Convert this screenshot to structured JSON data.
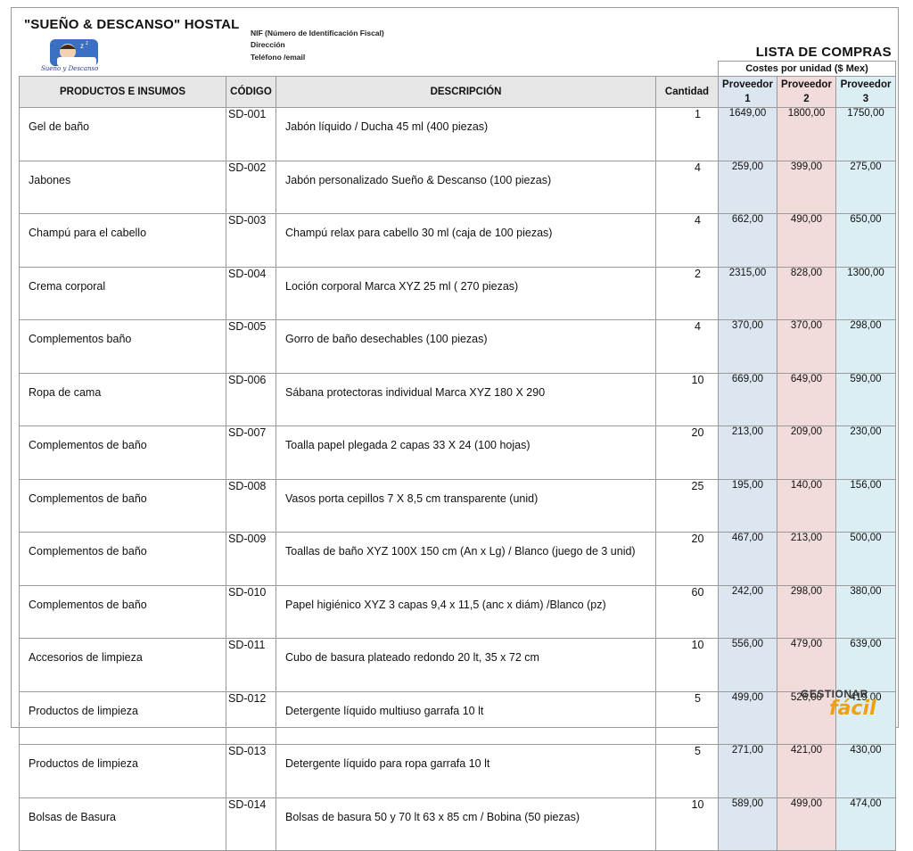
{
  "header": {
    "hostal_name": "\"SUEÑO & DESCANSO\"  HOSTAL",
    "logo_caption": "Sueño y Descanso",
    "nif": "NIF (Número de Identificación Fiscal)",
    "direccion": "Dirección",
    "telefono": "Teléfono /email",
    "list_title": "LISTA DE COMPRAS"
  },
  "columns": {
    "producto": "PRODUCTOS E INSUMOS",
    "codigo": "CÓDIGO",
    "descripcion": "DESCRIPCIÓN",
    "cantidad": "Cantidad",
    "costes": "Costes por unidad ($ Mex)",
    "prov1": "Proveedor 1",
    "prov2": "Proveedor 2",
    "prov3": "Proveedor 3"
  },
  "rows": [
    {
      "producto": "Gel de baño",
      "codigo": "SD-001",
      "descripcion": "Jabón líquido / Ducha 45 ml  (400 piezas)",
      "cantidad": "1",
      "p1": "1649,00",
      "p2": "1800,00",
      "p3": "1750,00"
    },
    {
      "producto": "Jabones",
      "codigo": "SD-002",
      "descripcion": "Jabón  personalizado Sueño & Descanso (100 piezas)",
      "cantidad": "4",
      "p1": "259,00",
      "p2": "399,00",
      "p3": "275,00"
    },
    {
      "producto": "Champú para el cabello",
      "codigo": "SD-003",
      "descripcion": "Champú relax para cabello 30 ml (caja de 100 piezas)",
      "cantidad": "4",
      "p1": "662,00",
      "p2": "490,00",
      "p3": "650,00"
    },
    {
      "producto": "Crema corporal",
      "codigo": "SD-004",
      "descripcion": "Loción corporal Marca XYZ 25 ml ( 270 piezas)",
      "cantidad": "2",
      "p1": "2315,00",
      "p2": "828,00",
      "p3": "1300,00"
    },
    {
      "producto": "Complementos baño",
      "codigo": "SD-005",
      "descripcion": "Gorro de baño desechables (100 piezas)",
      "cantidad": "4",
      "p1": "370,00",
      "p2": "370,00",
      "p3": "298,00"
    },
    {
      "producto": "Ropa de cama",
      "codigo": "SD-006",
      "descripcion": "Sábana protectoras individual Marca XYZ 180 X 290",
      "cantidad": "10",
      "p1": "669,00",
      "p2": "649,00",
      "p3": "590,00"
    },
    {
      "producto": "Complementos de baño",
      "codigo": "SD-007",
      "descripcion": "Toalla papel plegada 2 capas 33 X 24 (100 hojas)",
      "cantidad": "20",
      "p1": "213,00",
      "p2": "209,00",
      "p3": "230,00"
    },
    {
      "producto": "Complementos de baño",
      "codigo": "SD-008",
      "descripcion": "Vasos porta cepillos 7 X 8,5 cm transparente (unid)",
      "cantidad": "25",
      "p1": "195,00",
      "p2": "140,00",
      "p3": "156,00"
    },
    {
      "producto": "Complementos  de baño",
      "codigo": "SD-009",
      "descripcion": "Toallas  de baño XYZ 100X 150 cm (An x Lg) / Blanco (juego de 3 unid)",
      "cantidad": "20",
      "p1": "467,00",
      "p2": "213,00",
      "p3": "500,00"
    },
    {
      "producto": "Complementos de baño",
      "codigo": "SD-010",
      "descripcion": "Papel higiénico XYZ 3 capas 9,4 x 11,5 (anc x diám) /Blanco (pz)",
      "cantidad": "60",
      "p1": "242,00",
      "p2": "298,00",
      "p3": "380,00"
    },
    {
      "producto": "Accesorios de limpieza",
      "codigo": "SD-011",
      "descripcion": "Cubo de basura plateado redondo  20 lt, 35 x 72 cm",
      "cantidad": "10",
      "p1": "556,00",
      "p2": "479,00",
      "p3": "639,00"
    },
    {
      "producto": "Productos de  limpieza",
      "codigo": "SD-012",
      "descripcion": "Detergente líquido multiuso garrafa 10 lt",
      "cantidad": "5",
      "p1": "499,00",
      "p2": "526,00",
      "p3": "419,00"
    },
    {
      "producto": "Productos de  limpieza",
      "codigo": "SD-013",
      "descripcion": "Detergente líquido para ropa garrafa 10 lt",
      "cantidad": "5",
      "p1": "271,00",
      "p2": "421,00",
      "p3": "430,00"
    },
    {
      "producto": "Bolsas de Basura",
      "codigo": "SD-014",
      "descripcion": "Bolsas de basura 50 y 70 lt 63 x 85 cm / Bobina (50 piezas)",
      "cantidad": "10",
      "p1": "589,00",
      "p2": "499,00",
      "p3": "474,00"
    }
  ],
  "footer": {
    "brand_top": "GESTIONAR",
    "brand_bottom": "fácil"
  },
  "colors": {
    "prov1": "#dce6f1",
    "prov2": "#f2dcdb",
    "prov3": "#daeef3",
    "header_gray": "#e6e6e6",
    "brand_orange": "#f0a012"
  }
}
